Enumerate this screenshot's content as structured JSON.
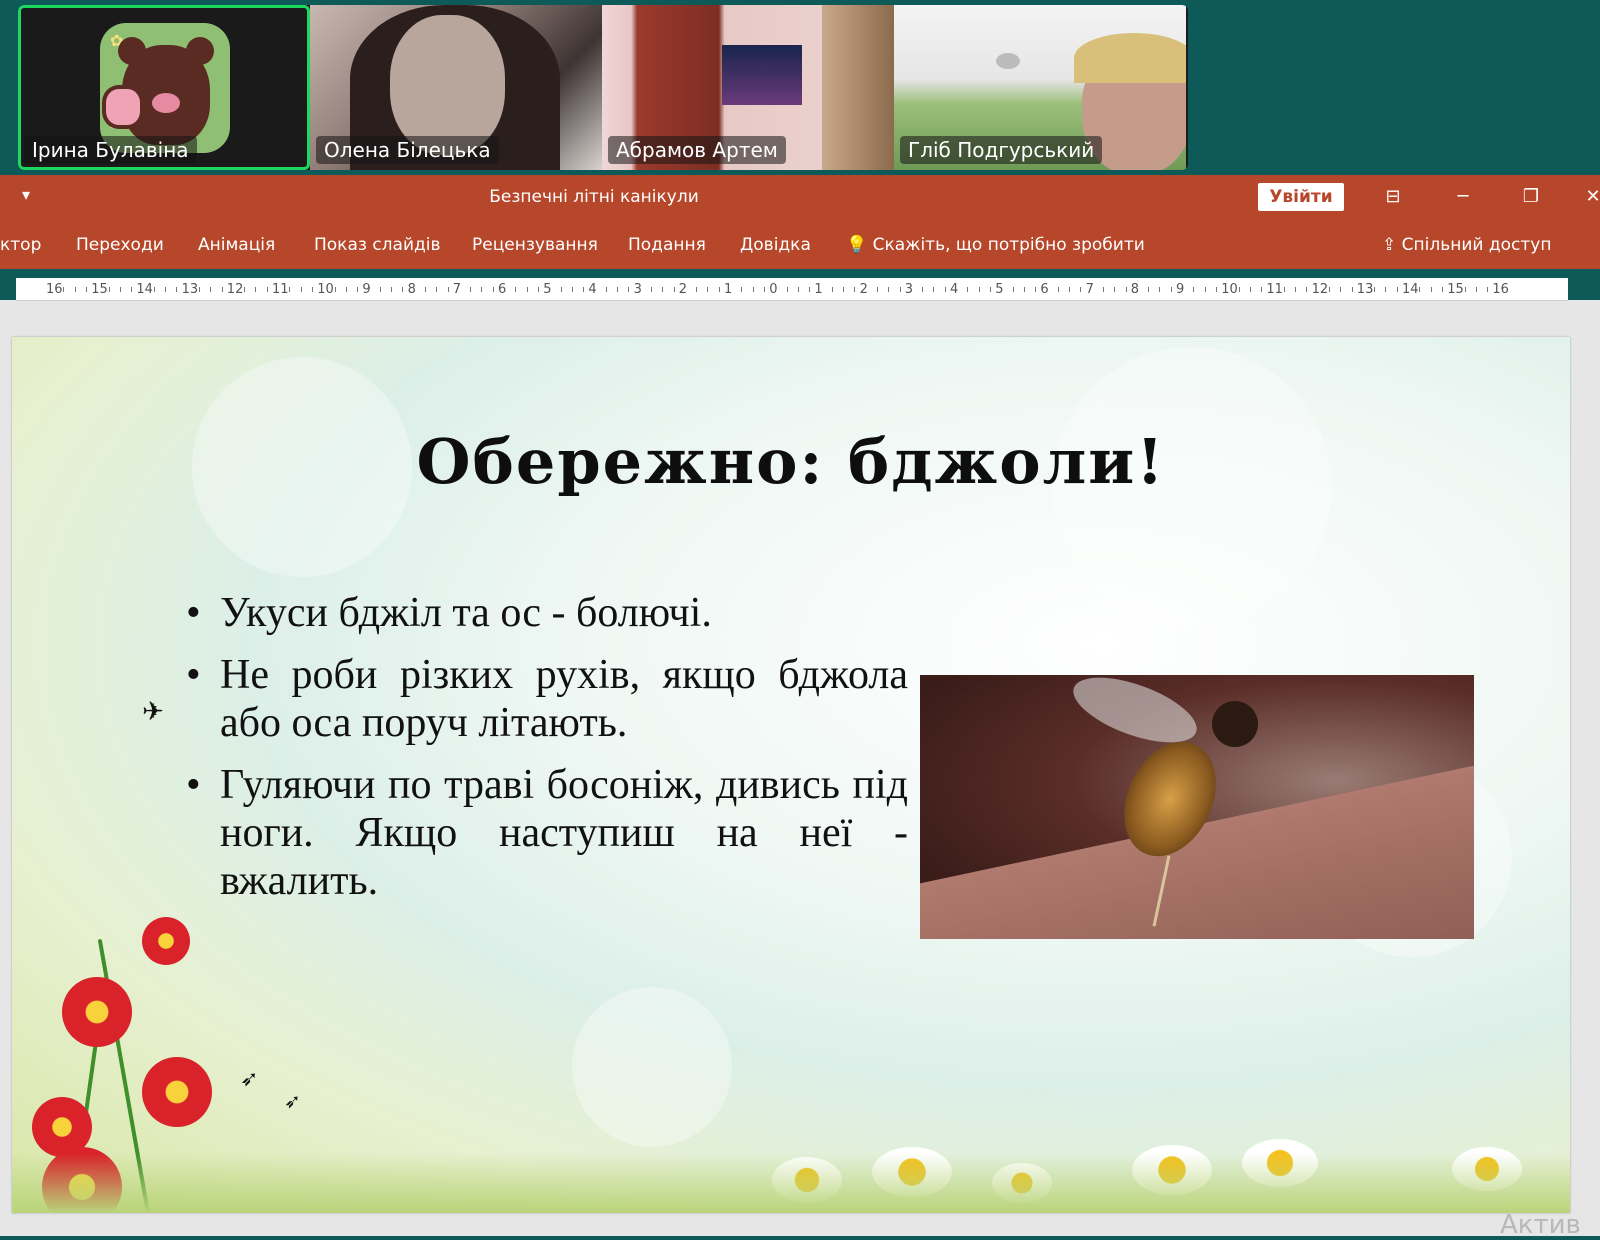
{
  "meeting": {
    "participants": [
      {
        "name": "Ірина Булавіна",
        "active": true
      },
      {
        "name": "Олена Білецька",
        "active": false
      },
      {
        "name": "Абрамов Артем",
        "active": false
      },
      {
        "name": "Гліб Подгурський",
        "active": false
      }
    ],
    "active_speaker_color": "#1ed760"
  },
  "powerpoint": {
    "accent_color": "#b7472a",
    "quick_access_icon": "customize-toolbar-icon",
    "title": "Безпечні літні канікули",
    "signin_label": "Увійти",
    "window_controls": {
      "ribbon_display_icon": "ribbon-display-icon",
      "minimize_icon": "minimize-icon",
      "restore_icon": "restore-icon",
      "close_icon": "close-icon"
    },
    "ribbon_tabs": [
      "ктор",
      "Переходи",
      "Анімація",
      "Показ слайдів",
      "Рецензування",
      "Подання",
      "Довідка"
    ],
    "tell_me": {
      "icon": "lightbulb-icon",
      "label": "Скажіть, що потрібно зробити"
    },
    "share": {
      "icon": "share-icon",
      "label": "Спільний доступ"
    },
    "ruler_ticks": [
      "16",
      "15",
      "14",
      "13",
      "12",
      "11",
      "10",
      "9",
      "8",
      "7",
      "6",
      "5",
      "4",
      "3",
      "2",
      "1",
      "0",
      "1",
      "2",
      "3",
      "4",
      "5",
      "6",
      "7",
      "8",
      "9",
      "10",
      "11",
      "12",
      "13",
      "14",
      "15",
      "16"
    ]
  },
  "slide": {
    "title": "Обережно: бджоли!",
    "bullets": [
      "Укуси бджіл та ос - болючі.",
      " Не роби різких рухів, якщо бджола або оса поруч літають.",
      "Гуляючи по траві босоніж, дивись під ноги. Якщо наступиш на неї - вжалить."
    ],
    "image": "bee-photo"
  },
  "watermark": "Актив"
}
